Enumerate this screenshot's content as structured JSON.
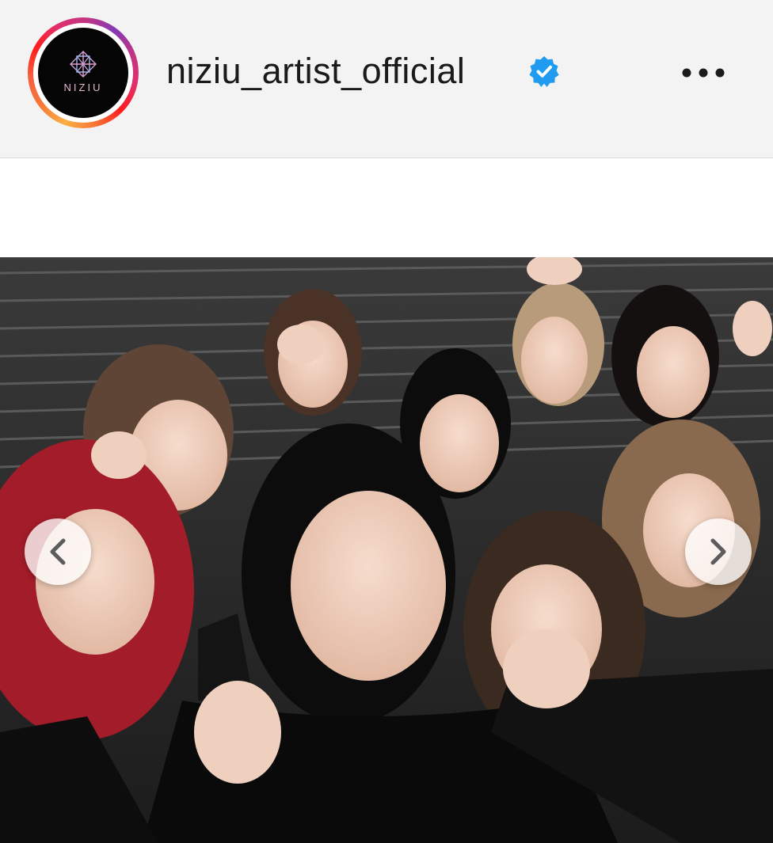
{
  "post": {
    "account": {
      "username": "niziu_artist_official",
      "avatar_logo_text": "NIZIU",
      "verified": true,
      "verified_icon": "verified-badge-icon",
      "verified_color": "#1f9bf0"
    },
    "more_icon": "more-horizontal-icon",
    "carousel": {
      "prev_icon": "chevron-left-icon",
      "next_icon": "chevron-right-icon"
    },
    "story_ring_colors": [
      "#fcaf45",
      "#fd1d1d",
      "#e1306c",
      "#833ab4"
    ]
  }
}
